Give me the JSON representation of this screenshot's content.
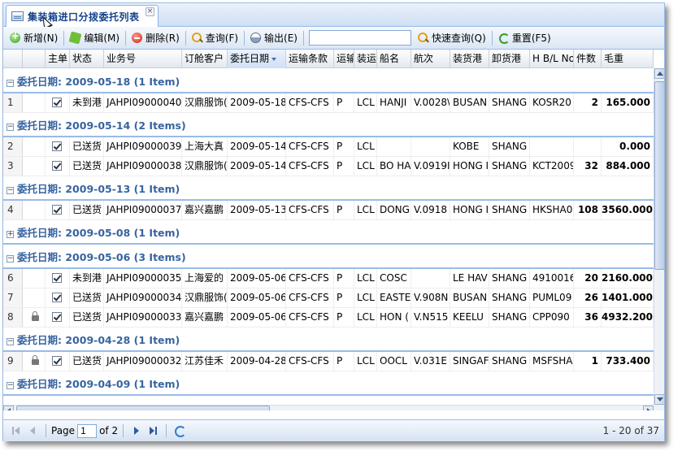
{
  "tab": {
    "title": "集装箱进口分拨委托列表",
    "close_glyph": "×"
  },
  "toolbar": {
    "add_label": "新增(N)",
    "edit_label": "编辑(M)",
    "delete_label": "删除(R)",
    "query_label": "查询(F)",
    "export_label": "输出(E)",
    "search_placeholder": "",
    "quick_query_label": "快速查询(Q)",
    "reset_label": "重置(F5)"
  },
  "grid": {
    "columns": [
      {
        "key": "rn",
        "label": ""
      },
      {
        "key": "lock",
        "label": ""
      },
      {
        "key": "main",
        "label": "主单"
      },
      {
        "key": "status",
        "label": "状态"
      },
      {
        "key": "biz",
        "label": "业务号"
      },
      {
        "key": "cust",
        "label": "订舱客户"
      },
      {
        "key": "date",
        "label": "委托日期"
      },
      {
        "key": "terms",
        "label": "运输条款"
      },
      {
        "key": "ship",
        "label": "运输"
      },
      {
        "key": "load",
        "label": "装运"
      },
      {
        "key": "vessel",
        "label": "船名"
      },
      {
        "key": "voy",
        "label": "航次"
      },
      {
        "key": "pol",
        "label": "装货港"
      },
      {
        "key": "pod",
        "label": "卸货港"
      },
      {
        "key": "hbl",
        "label": "H B/L No"
      },
      {
        "key": "pkgs",
        "label": "件数"
      },
      {
        "key": "gw",
        "label": "毛重"
      }
    ],
    "groups": [
      {
        "header": "委托日期: 2009-05-18 (1 Item)",
        "expanded": true,
        "rows": [
          {
            "rn": "1",
            "lock": false,
            "main": true,
            "status": "未到港",
            "biz": "JAHPI09000040",
            "cust": "汉鼎服饰(",
            "date": "2009-05-18",
            "terms": "CFS-CFS",
            "ship": "P",
            "load": "LCL",
            "vessel": "HANJI",
            "voy": "V.0028\\",
            "pol": "BUSAN",
            "pod": "SHANG",
            "hbl": "KOSR20",
            "pkgs": "2",
            "gw": "165.000"
          }
        ]
      },
      {
        "header": "委托日期: 2009-05-14 (2 Items)",
        "expanded": true,
        "rows": [
          {
            "rn": "2",
            "lock": false,
            "main": true,
            "status": "已送货",
            "biz": "JAHPI09000039",
            "cust": "上海大真",
            "date": "2009-05-14",
            "terms": "CFS-CFS",
            "ship": "P",
            "load": "LCL",
            "vessel": "",
            "voy": "",
            "pol": "KOBE",
            "pod": "SHANG",
            "hbl": "",
            "pkgs": "",
            "gw": "0.000"
          },
          {
            "rn": "3",
            "lock": false,
            "main": true,
            "status": "已送货",
            "biz": "JAHPI09000038",
            "cust": "汉鼎服饰(",
            "date": "2009-05-14",
            "terms": "CFS-CFS",
            "ship": "P",
            "load": "LCL",
            "vessel": "BO HA",
            "voy": "V.0919I",
            "pol": "HONG I",
            "pod": "SHANG",
            "hbl": "KCT2009",
            "pkgs": "32",
            "gw": "884.000"
          }
        ]
      },
      {
        "header": "委托日期: 2009-05-13 (1 Item)",
        "expanded": true,
        "rows": [
          {
            "rn": "4",
            "lock": false,
            "main": true,
            "status": "已送货",
            "biz": "JAHPI09000037",
            "cust": "嘉兴嘉鹏",
            "date": "2009-05-13",
            "terms": "CFS-CFS",
            "ship": "P",
            "load": "LCL",
            "vessel": "DONG",
            "voy": "V.0918",
            "pol": "HONG I",
            "pod": "SHANG",
            "hbl": "HKSHA0",
            "pkgs": "108",
            "gw": "3560.000"
          }
        ]
      },
      {
        "header": "委托日期: 2009-05-08 (1 Item)",
        "expanded": false,
        "rows": []
      },
      {
        "header": "委托日期: 2009-05-06 (3 Items)",
        "expanded": true,
        "rows": [
          {
            "rn": "6",
            "lock": false,
            "main": true,
            "status": "未到港",
            "biz": "JAHPI09000035",
            "cust": "上海爱的",
            "date": "2009-05-06",
            "terms": "CFS-CFS",
            "ship": "P",
            "load": "LCL",
            "vessel": "COSC",
            "voy": "",
            "pol": "LE HAV",
            "pod": "SHANG",
            "hbl": "4910016",
            "pkgs": "20",
            "gw": "2160.000"
          },
          {
            "rn": "7",
            "lock": false,
            "main": true,
            "status": "已送货",
            "biz": "JAHPI09000034",
            "cust": "汉鼎服饰(",
            "date": "2009-05-06",
            "terms": "CFS-CFS",
            "ship": "P",
            "load": "LCL",
            "vessel": "EASTE",
            "voy": "V.908N",
            "pol": "BUSAN",
            "pod": "SHANG",
            "hbl": "PUML09",
            "pkgs": "26",
            "gw": "1401.000"
          },
          {
            "rn": "8",
            "lock": true,
            "main": true,
            "status": "已送货",
            "biz": "JAHPI09000033",
            "cust": "嘉兴嘉鹏",
            "date": "2009-05-06",
            "terms": "CFS-CFS",
            "ship": "P",
            "load": "LCL",
            "vessel": "HON (",
            "voy": "V.N515",
            "pol": "KEELU",
            "pod": "SHANG",
            "hbl": "CPP090",
            "pkgs": "36",
            "gw": "4932.200"
          }
        ]
      },
      {
        "header": "委托日期: 2009-04-28 (1 Item)",
        "expanded": true,
        "rows": [
          {
            "rn": "9",
            "lock": true,
            "main": true,
            "status": "已送货",
            "biz": "JAHPI09000032",
            "cust": "江苏佳禾",
            "date": "2009-04-28",
            "terms": "CFS-CFS",
            "ship": "P",
            "load": "LCL",
            "vessel": "OOCL",
            "voy": "V.031E",
            "pol": "SINGAF",
            "pod": "SHANG",
            "hbl": "MSFSHA",
            "pkgs": "1",
            "gw": "733.400"
          }
        ]
      },
      {
        "header": "委托日期: 2009-04-09 (1 Item)",
        "expanded": true,
        "rows": []
      }
    ]
  },
  "pager": {
    "page_label": "Page",
    "page_value": "1",
    "of_label": "of 2",
    "info": "1 - 20 of 37"
  },
  "colors": {
    "group_text": "#3764a0",
    "border": "#99bbe8",
    "tab_title": "#15428b"
  }
}
